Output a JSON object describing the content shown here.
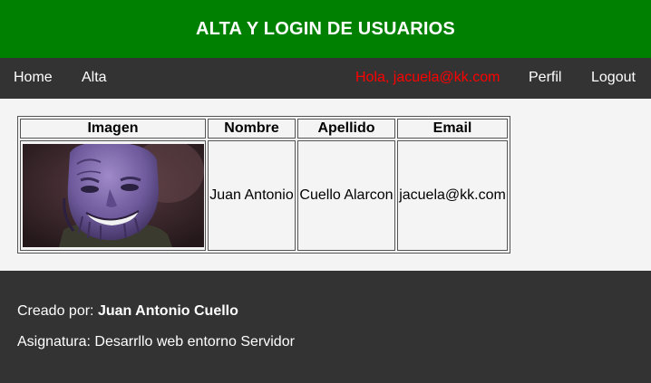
{
  "header": {
    "title": "ALTA Y LOGIN DE USUARIOS"
  },
  "nav": {
    "home": "Home",
    "alta": "Alta",
    "greeting": "Hola, jacuela@kk.com",
    "perfil": "Perfil",
    "logout": "Logout"
  },
  "table": {
    "headers": [
      "Imagen",
      "Nombre",
      "Apellido",
      "Email"
    ],
    "rows": [
      {
        "image": "thanos-avatar",
        "nombre": "Juan Antonio",
        "apellido": "Cuello Alarcon",
        "email": "jacuela@kk.com"
      }
    ]
  },
  "footer": {
    "created_label": "Creado por: ",
    "author": "Juan Antonio Cuello",
    "subject": "Asignatura: Desarrllo web entorno Servidor"
  },
  "colors": {
    "header_bg": "#008000",
    "nav_bg": "#333333",
    "greeting": "#ff0000",
    "content_bg": "#f4f4f4"
  }
}
